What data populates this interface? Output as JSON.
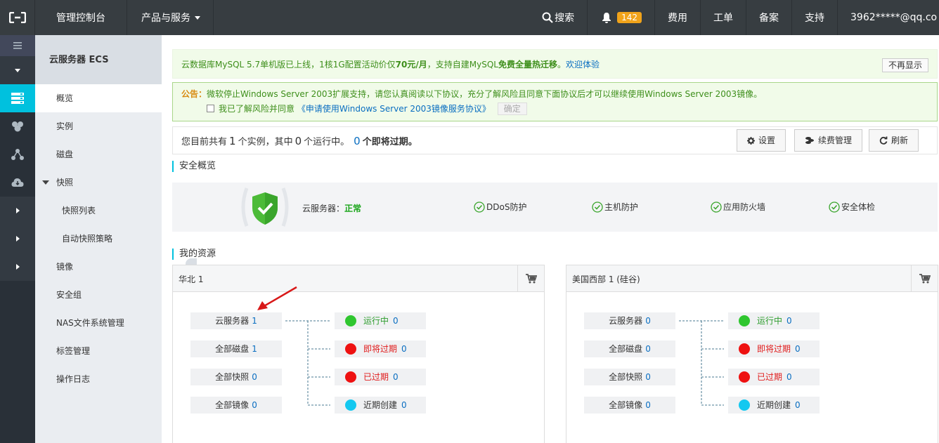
{
  "topbar": {
    "console": "管理控制台",
    "products": "产品与服务",
    "search": "搜索",
    "notif_count": "142",
    "fee": "费用",
    "ticket": "工单",
    "beian": "备案",
    "support": "支持",
    "user": "3962*****@qq.co"
  },
  "subnav": {
    "title": "云服务器 ECS",
    "items": [
      "概览",
      "实例",
      "磁盘",
      "快照",
      "快照列表",
      "自动快照策略",
      "镜像",
      "安全组",
      "NAS文件系统管理",
      "标签管理",
      "操作日志"
    ]
  },
  "notice1": {
    "text_a": "云数据库MySQL 5.7单机版已上线，1核1G配置活动价仅",
    "price": "70元/月",
    "text_b": "，支持自建MySQL",
    "highlight": "免费全量热迁移",
    "text_c": "。",
    "link": "欢迎体验",
    "dismiss": "不再显示"
  },
  "notice2": {
    "label": "公告：",
    "text": "微软停止Windows Server 2003扩展支持，请您认真阅读以下协议，充分了解风险且同意下面协议后才可以继续使用Windows Server 2003镜像。",
    "agree": "我已了解风险并同意",
    "agreement_link": "《申请使用Windows Server 2003镜像服务协议》",
    "confirm": "确定"
  },
  "summary": {
    "prefix": "您目前共有",
    "instances": "1",
    "mid1": "个实例，其中",
    "running": "0",
    "mid2": "个运行中。",
    "expiring": "0",
    "suffix": "个即将过期。",
    "settings": "设置",
    "renew": "续费管理",
    "refresh": "刷新"
  },
  "security": {
    "title": "安全概览",
    "status_label": "云服务器：",
    "status_value": "正常",
    "items": [
      "DDoS防护",
      "主机防护",
      "应用防火墙",
      "安全体检"
    ]
  },
  "resources": {
    "title": "我的资源",
    "regions": [
      {
        "name": "华北 1",
        "left": [
          {
            "label": "云服务器",
            "value": "1"
          },
          {
            "label": "全部磁盘",
            "value": "1"
          },
          {
            "label": "全部快照",
            "value": "0"
          },
          {
            "label": "全部镜像",
            "value": "0"
          }
        ],
        "right": [
          {
            "label": "运行中",
            "value": "0",
            "color": "#2fc62f",
            "text_color": "#2e9d2e"
          },
          {
            "label": "即将过期",
            "value": "0",
            "color": "#ee1111",
            "text_color": "#e01a1a"
          },
          {
            "label": "已过期",
            "value": "0",
            "color": "#ee1111",
            "text_color": "#e01a1a"
          },
          {
            "label": "近期创建",
            "value": "0",
            "color": "#14c8f0",
            "text_color": "#333333"
          }
        ]
      },
      {
        "name": "美国西部 1 (硅谷)",
        "left": [
          {
            "label": "云服务器",
            "value": "0"
          },
          {
            "label": "全部磁盘",
            "value": "0"
          },
          {
            "label": "全部快照",
            "value": "0"
          },
          {
            "label": "全部镜像",
            "value": "0"
          }
        ],
        "right": [
          {
            "label": "运行中",
            "value": "0",
            "color": "#2fc62f",
            "text_color": "#2e9d2e"
          },
          {
            "label": "即将过期",
            "value": "0",
            "color": "#ee1111",
            "text_color": "#e01a1a"
          },
          {
            "label": "已过期",
            "value": "0",
            "color": "#ee1111",
            "text_color": "#e01a1a"
          },
          {
            "label": "近期创建",
            "value": "0",
            "color": "#14c8f0",
            "text_color": "#333333"
          }
        ]
      }
    ]
  }
}
